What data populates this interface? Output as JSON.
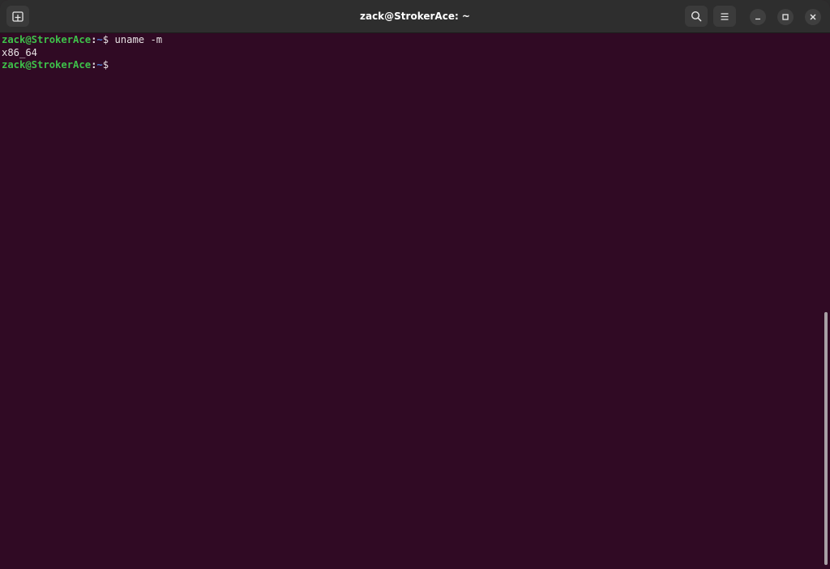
{
  "window": {
    "title": "zack@StrokerAce: ~"
  },
  "header": {
    "new_tab_icon": "new-tab-icon",
    "search_icon": "search-icon",
    "menu_icon": "hamburger-menu-icon"
  },
  "window_controls": {
    "minimize_icon": "minimize-icon",
    "maximize_icon": "maximize-icon",
    "close_icon": "close-icon"
  },
  "terminal": {
    "lines": [
      {
        "user_host": "zack@StrokerAce",
        "sep": ":",
        "path": "~",
        "symbol": "$ ",
        "command": "uname -m"
      },
      {
        "output": "x86_64"
      },
      {
        "user_host": "zack@StrokerAce",
        "sep": ":",
        "path": "~",
        "symbol": "$ ",
        "command": ""
      }
    ]
  },
  "colors": {
    "background": "#300a24",
    "titlebar": "#2e2e2e",
    "prompt_user": "#3ec14a",
    "prompt_path": "#4f7fd8",
    "text": "#e7e2e4"
  }
}
